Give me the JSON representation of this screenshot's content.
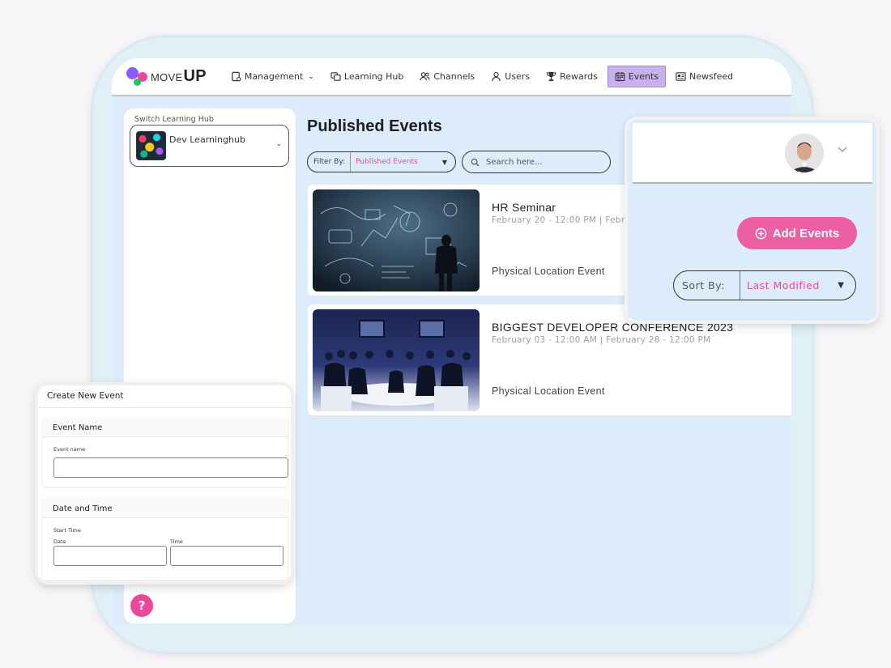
{
  "app": {
    "logo_small": "MOVE",
    "logo_big": "UP"
  },
  "nav": [
    {
      "label": "Management",
      "icon": "management-icon",
      "caret": "⌄"
    },
    {
      "label": "Learning Hub",
      "icon": "learning-hub-icon"
    },
    {
      "label": "Channels",
      "icon": "channels-icon"
    },
    {
      "label": "Users",
      "icon": "user-icon"
    },
    {
      "label": "Rewards",
      "icon": "trophy-icon"
    },
    {
      "label": "Events",
      "icon": "calendar-icon",
      "active": true
    },
    {
      "label": "Newsfeed",
      "icon": "newsfeed-icon"
    }
  ],
  "sidebar": {
    "label": "Switch Learning Hub",
    "hub_name": "Dev Learninghub"
  },
  "main": {
    "title": "Published Events",
    "filter_label": "Filter By:",
    "filter_value": "Published Events",
    "search_placeholder": "Search here..."
  },
  "events": [
    {
      "title": "HR Seminar",
      "date": "February 20 - 12:00 PM | Febr",
      "type": "Physical Location Event"
    },
    {
      "title": "BIGGEST DEVELOPER CONFERENCE 2023",
      "date": "February 03 - 12:00 AM | February 28 - 12:00 PM",
      "type": "Physical Location Event"
    }
  ],
  "popup_right": {
    "add_events": "Add Events",
    "sort_label": "Sort By:",
    "sort_value": "Last Modified"
  },
  "popup_left": {
    "title": "Create New Event",
    "event_name_section": "Event Name",
    "event_name_label": "Event name",
    "date_time_section": "Date and Time",
    "start_time_label": "Start Time",
    "date_label": "Date",
    "time_label": "Time"
  },
  "help": {
    "label": "?"
  },
  "colors": {
    "accent_pink": "#ec4899",
    "active_nav": "#c8b0ee",
    "screen_bg": "#dcecfa"
  }
}
